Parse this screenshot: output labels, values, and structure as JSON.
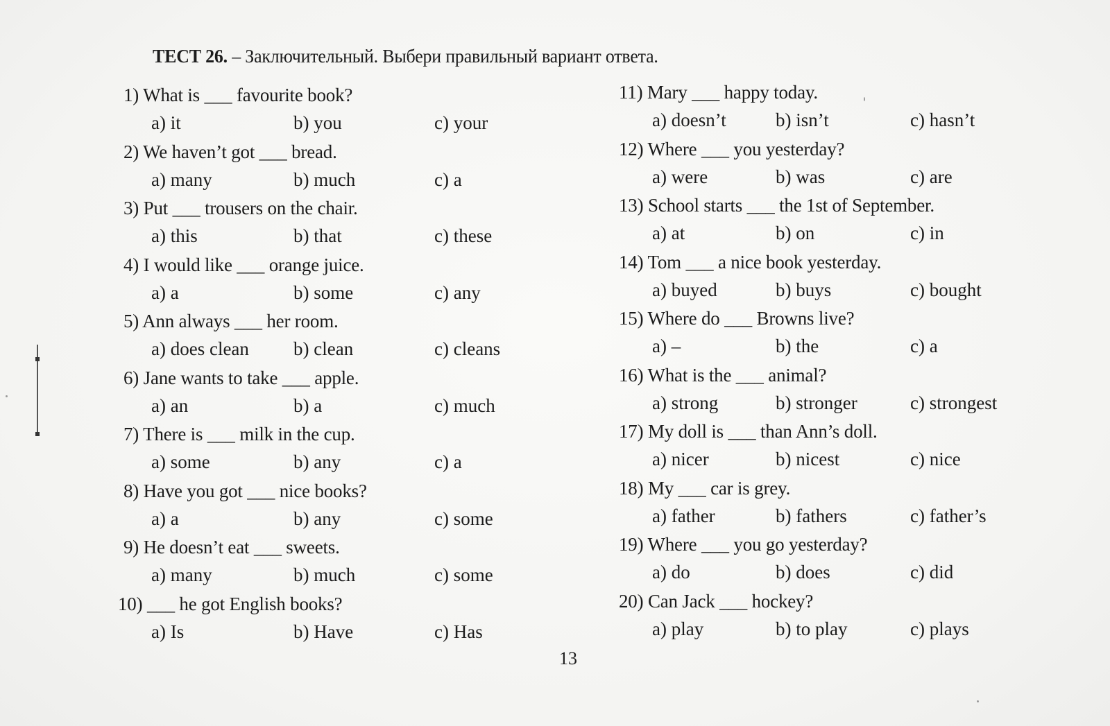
{
  "header": {
    "test_label": "ТЕСТ 26.",
    "instruction": "– Заключительный. Выбери правильный вариант ответа."
  },
  "questions_left": [
    {
      "num": "1)",
      "text": "What is ___ favourite book?",
      "options": [
        "a) it",
        "b) you",
        "c) your"
      ]
    },
    {
      "num": "2)",
      "text": "We haven’t got ___ bread.",
      "options": [
        "a) many",
        "b) much",
        "c) a"
      ]
    },
    {
      "num": "3)",
      "text": "Put ___ trousers on the chair.",
      "options": [
        "a) this",
        "b) that",
        "c) these"
      ]
    },
    {
      "num": "4)",
      "text": "I would like ___ orange juice.",
      "options": [
        "a) a",
        "b) some",
        "c) any"
      ]
    },
    {
      "num": "5)",
      "text": "Ann always ___ her room.",
      "options": [
        "a) does clean",
        "b) clean",
        "c) cleans"
      ]
    },
    {
      "num": "6)",
      "text": "Jane wants to take ___ apple.",
      "options": [
        "a) an",
        "b) a",
        "c) much"
      ]
    },
    {
      "num": "7)",
      "text": "There is ___ milk in the cup.",
      "options": [
        "a) some",
        "b) any",
        "c) a"
      ]
    },
    {
      "num": "8)",
      "text": "Have you got ___ nice books?",
      "options": [
        "a) a",
        "b) any",
        "c) some"
      ]
    },
    {
      "num": "9)",
      "text": "He doesn’t eat ___ sweets.",
      "options": [
        "a) many",
        "b) much",
        "c) some"
      ]
    },
    {
      "num": "10)",
      "text": "___ he got English books?",
      "options": [
        "a) Is",
        "b) Have",
        "c) Has"
      ]
    }
  ],
  "questions_right": [
    {
      "num": "11)",
      "text": "Mary ___ happy today.",
      "options": [
        "a) doesn’t",
        "b) isn’t",
        "c) hasn’t"
      ]
    },
    {
      "num": "12)",
      "text": "Where ___ you yesterday?",
      "options": [
        "a) were",
        "b) was",
        "c) are"
      ]
    },
    {
      "num": "13)",
      "text": "School starts ___ the 1st of September.",
      "options": [
        "a) at",
        "b) on",
        "c) in"
      ]
    },
    {
      "num": "14)",
      "text": "Tom ___ a nice book yesterday.",
      "options": [
        "a) buyed",
        "b) buys",
        "c) bought"
      ]
    },
    {
      "num": "15)",
      "text": "Where do ___ Browns live?",
      "options": [
        "a) –",
        "b) the",
        "c) a"
      ]
    },
    {
      "num": "16)",
      "text": "What is the ___ animal?",
      "options": [
        "a) strong",
        "b) stronger",
        "c) strongest"
      ]
    },
    {
      "num": "17)",
      "text": "My doll is ___ than Ann’s doll.",
      "options": [
        "a) nicer",
        "b) nicest",
        "c) nice"
      ]
    },
    {
      "num": "18)",
      "text": "My ___ car is grey.",
      "options": [
        "a) father",
        "b) fathers",
        "c) father’s"
      ]
    },
    {
      "num": "19)",
      "text": "Where ___ you go yesterday?",
      "options": [
        "a) do",
        "b) does",
        "c) did"
      ]
    },
    {
      "num": "20)",
      "text": "Can Jack ___ hockey?",
      "options": [
        "a) play",
        "b) to play",
        "c) plays"
      ]
    }
  ],
  "footer": {
    "page_number": "13"
  }
}
